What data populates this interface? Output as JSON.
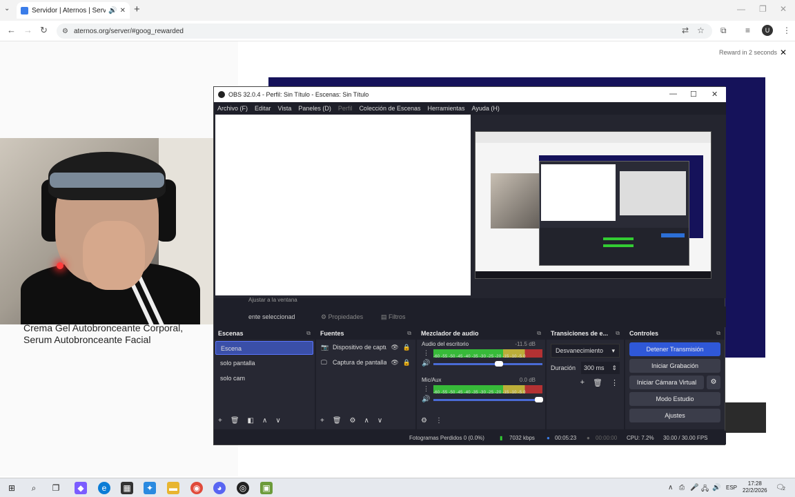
{
  "browser": {
    "tab_title": "Servidor | Aternos | Servido",
    "url": "aternos.org/server/#goog_rewarded"
  },
  "page": {
    "reward_text": "Reward in 2 seconds",
    "product_text": "Crema Gel Autobronceante Corporal, Serum Autobronceante Facial"
  },
  "obs": {
    "title": "OBS 32.0.4 - Perfil: Sin Título - Escenas: Sin Título",
    "menu": [
      "Archivo (F)",
      "Editar",
      "Vista",
      "Paneles (D)",
      "Perfil",
      "Colección de Escenas",
      "Herramientas",
      "Ayuda (H)"
    ],
    "preview_footer": "Ajustar a la ventana",
    "no_source_selected": "ente seleccionad",
    "properties_label": "Propiedades",
    "filters_label": "Filtros",
    "scenes": {
      "header": "Escenas",
      "items": [
        "Escena",
        "solo pantalla",
        "solo cam"
      ]
    },
    "sources": {
      "header": "Fuentes",
      "items": [
        "Dispositivo de captu",
        "Captura de pantalla"
      ]
    },
    "mixer": {
      "header": "Mezclador de audio",
      "channels": [
        {
          "name": "Audio del escritorio",
          "db": "-11.5 dB",
          "volume": 0.6
        },
        {
          "name": "Mic/Aux",
          "db": "0.0 dB",
          "volume": 0.97
        }
      ],
      "scale": "-60 -55 -50 -45 -40 -35 -30 -25 -20 -15 -10 -5 0"
    },
    "transitions": {
      "header": "Transiciones de e...",
      "selected": "Desvanecimiento",
      "duration_label": "Duración",
      "duration_value": "300 ms"
    },
    "controls": {
      "header": "Controles",
      "stop_stream": "Detener Transmisión",
      "start_recording": "Iniciar Grabación",
      "start_virtual_cam": "Iniciar Cámara Virtual",
      "studio_mode": "Modo Estudio",
      "settings": "Ajustes"
    },
    "status": {
      "dropped_frames": "Fotogramas Perdidos 0 (0.0%)",
      "bitrate": "7032 kbps",
      "stream_time": "00:05:23",
      "rec_time": "00:00:00",
      "cpu": "CPU: 7.2%",
      "fps": "30.00 / 30.00 FPS"
    }
  },
  "taskbar": {
    "lang": "ESP",
    "time": "17:28",
    "date": "22/2/2026",
    "notifications": "2"
  }
}
